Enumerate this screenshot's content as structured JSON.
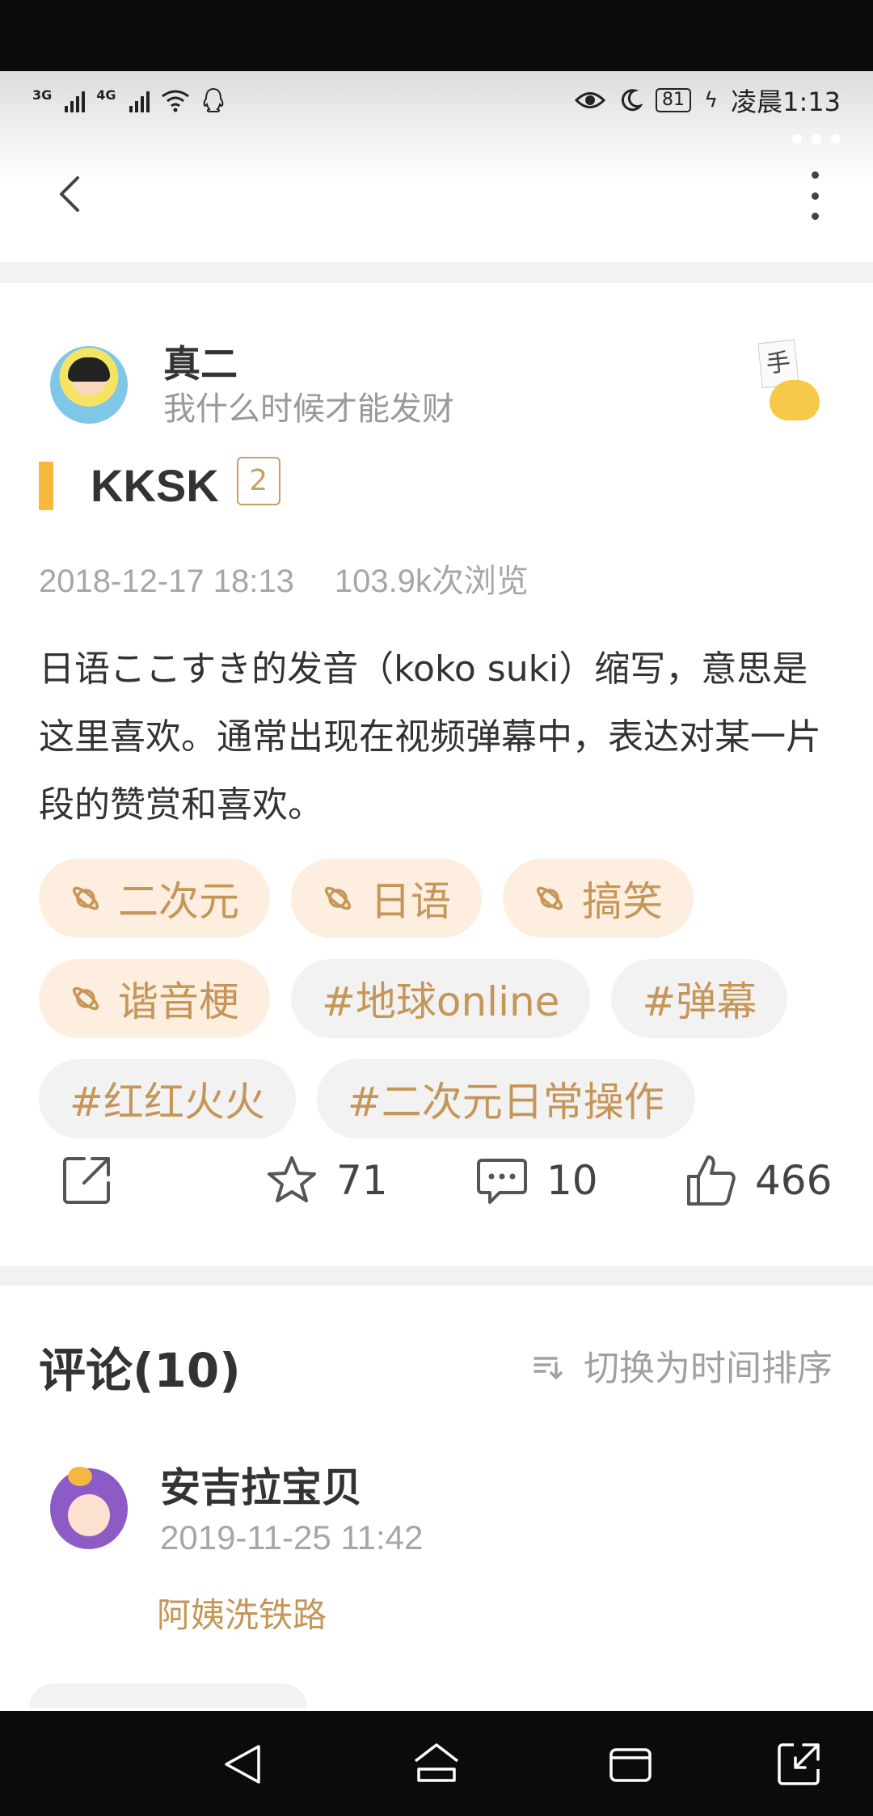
{
  "status_bar": {
    "net1": "3G",
    "net2": "4G",
    "battery": "81",
    "time": "凌晨1:13"
  },
  "post": {
    "author_name": "真二",
    "author_signature": "我什么时候才能发财",
    "badge_char": "手",
    "term": "KKSK",
    "term_count": "2",
    "date": "2018-12-17 18:13",
    "views": "103.9k次浏览",
    "description": "日语ここすき的发音（koko suki）缩写，意思是这里喜欢。通常出现在视频弹幕中，表达对某一片段的赞赏和喜欢。",
    "tags": [
      {
        "label": "二次元",
        "kind": "topic"
      },
      {
        "label": "日语",
        "kind": "topic"
      },
      {
        "label": "搞笑",
        "kind": "topic"
      },
      {
        "label": "谐音梗",
        "kind": "topic"
      },
      {
        "label": "#地球online",
        "kind": "hash"
      },
      {
        "label": "#弹幕",
        "kind": "hash"
      },
      {
        "label": "#红红火火",
        "kind": "hash"
      },
      {
        "label": "#二次元日常操作",
        "kind": "hash"
      }
    ],
    "actions": {
      "favorites": "71",
      "comments": "10",
      "likes": "466"
    }
  },
  "comments": {
    "header": "评论(10)",
    "sort_label": "切换为时间排序",
    "items": [
      {
        "name": "安吉拉宝贝",
        "time": "2019-11-25 11:42",
        "body": "阿姨洗铁路"
      }
    ]
  },
  "colors": {
    "accent_gold": "#c59658",
    "topic_tag_bg": "#fdeee0",
    "hash_tag_bg": "#f2f2f2",
    "term_bar": "#f6b93b"
  },
  "icons": [
    "back-icon",
    "more-icon",
    "share-icon",
    "star-icon",
    "comment-icon",
    "thumb-up-icon",
    "sort-icon",
    "planet-icon",
    "nav-back-icon",
    "nav-home-icon",
    "nav-recents-icon",
    "nav-expand-icon"
  ]
}
